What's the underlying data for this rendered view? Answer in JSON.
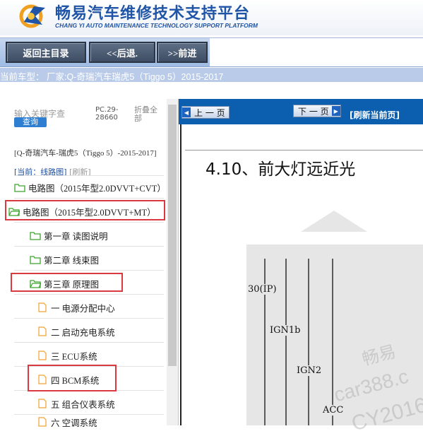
{
  "header": {
    "title": "畅易汽车维修技术支持平台",
    "subtitle": "CHANG YI AUTO MAINTENANCE TECHNOLOGY SUPPORT PLATFORM",
    "brand_color": "#1f54a6"
  },
  "toolbar": {
    "home_label": "返回主目录",
    "back_label": "<<后退.",
    "forward_label": ">>前进"
  },
  "current_model": "当前车型：  厂家:Q-奇瑞汽车瑞虎5（Tiggo 5）2015-2017",
  "sidebar": {
    "search_placeholder": "输入关键字查",
    "search_button": "查询",
    "pc_code": "PC.29-28660",
    "collapse_label": "折叠全部",
    "crumb": "[Q-奇瑞汽车-瑞虎5（Tiggo 5）-2015-2017]",
    "crumb_current": "[当前：线路图]",
    "crumb_refresh": "[刷新]",
    "items": [
      {
        "label": "电路图（2015年型2.0DVVT+CVT）",
        "icon": "folder-icon"
      },
      {
        "label": "电路图（2015年型2.0DVVT+MT）",
        "icon": "folder-open-icon"
      },
      {
        "label": "第一章 读图说明",
        "icon": "folder-icon"
      },
      {
        "label": "第二章 线束图",
        "icon": "folder-icon"
      },
      {
        "label": "第三章 原理图",
        "icon": "folder-open-icon"
      },
      {
        "label": "一 电源分配中心",
        "icon": "file-icon"
      },
      {
        "label": "二 启动充电系统",
        "icon": "file-icon"
      },
      {
        "label": "三 ECU系统",
        "icon": "file-icon"
      },
      {
        "label": "四 BCM系统",
        "icon": "file-icon"
      },
      {
        "label": "五 组合仪表系统",
        "icon": "file-icon"
      },
      {
        "label": "六 空调系统",
        "icon": "file-icon"
      }
    ],
    "highlight_color": "#d9393f"
  },
  "viewer": {
    "prev_label": "上 一 页",
    "next_label": "下 一 页",
    "refresh_label": "[刷新当前页]",
    "section_title": "4.10、前大灯远近光",
    "wire_labels": [
      "30(IP)",
      "IGN1b",
      "IGN2",
      "ACC"
    ],
    "watermarks": [
      "畅易",
      "car388.c",
      "CY2016"
    ]
  }
}
